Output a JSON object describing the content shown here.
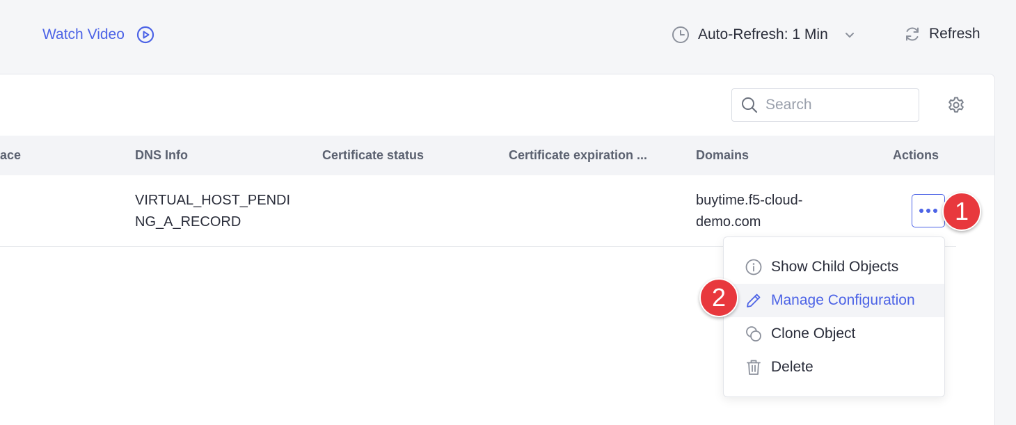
{
  "toolbar": {
    "watch_video_label": "Watch Video",
    "auto_refresh_label": "Auto-Refresh: 1 Min",
    "refresh_label": "Refresh"
  },
  "search": {
    "placeholder": "Search"
  },
  "table": {
    "columns": [
      "ace",
      "DNS Info",
      "Certificate status",
      "Certificate expiration ...",
      "Domains",
      "Actions"
    ],
    "rows": [
      {
        "dns_info_line1": "VIRTUAL_HOST_PENDI",
        "dns_info_line2": "NG_A_RECORD",
        "certificate_status": "",
        "certificate_expiration": "",
        "domains_line1": "buytime.f5-cloud-",
        "domains_line2": "demo.com"
      }
    ]
  },
  "actions_menu": {
    "items": [
      {
        "label": "Show Child Objects",
        "icon": "info-icon"
      },
      {
        "label": "Manage Configuration",
        "icon": "pencil-icon"
      },
      {
        "label": "Clone Object",
        "icon": "clone-icon"
      },
      {
        "label": "Delete",
        "icon": "trash-icon"
      }
    ],
    "highlighted_item": "Manage Configuration"
  },
  "annotations": {
    "badge_1": "1",
    "badge_2": "2"
  },
  "colors": {
    "accent": "#4c63e6",
    "badge": "#e8383d",
    "text": "#2a2d3a",
    "muted_header": "#5b6170"
  }
}
